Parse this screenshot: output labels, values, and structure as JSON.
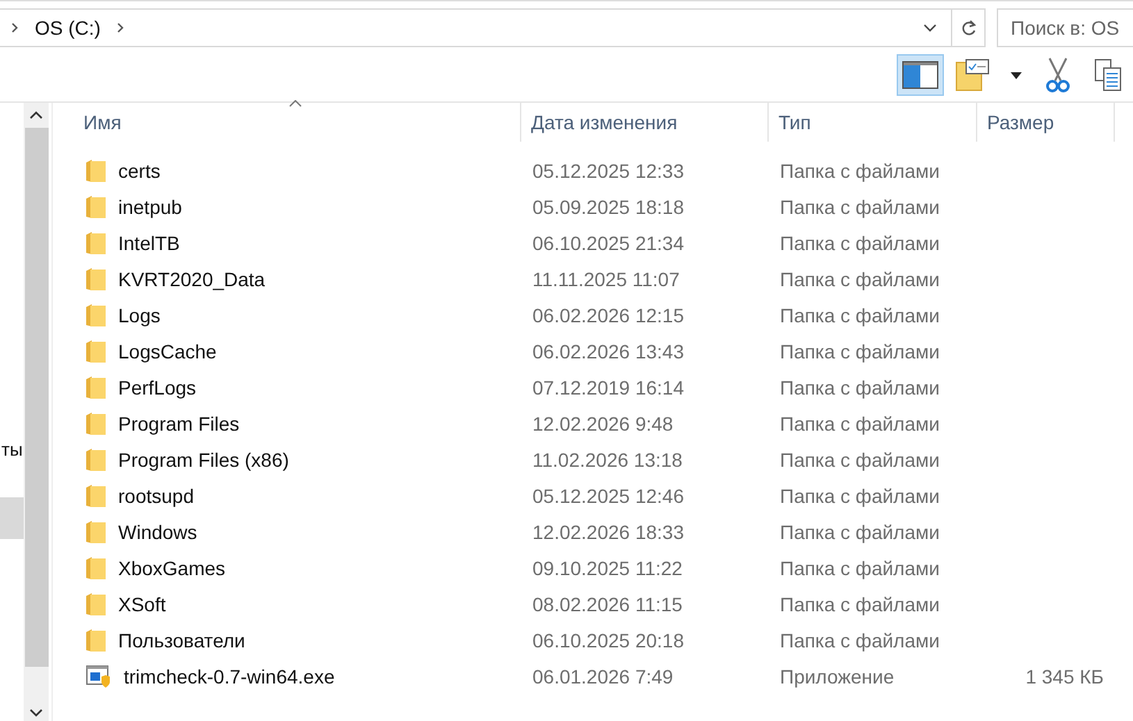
{
  "address_bar": {
    "path": [
      {
        "label": "OS (C:)"
      }
    ]
  },
  "search": {
    "placeholder": "Поиск в: OS"
  },
  "toolbar": {
    "buttons": [
      {
        "kind": "preview-pane",
        "selected": true
      },
      {
        "kind": "properties",
        "selected": false
      },
      {
        "kind": "cut",
        "selected": false
      },
      {
        "kind": "copy",
        "selected": false
      }
    ]
  },
  "navigation": {
    "items": [
      {
        "label": "ты",
        "selected": false
      },
      {
        "selected": true
      }
    ]
  },
  "table": {
    "columns": [
      {
        "label": "Имя",
        "sorted": true
      },
      {
        "label": "Дата изменения",
        "sorted": false
      },
      {
        "label": "Тип",
        "sorted": false
      },
      {
        "label": "Размер",
        "sorted": false
      }
    ],
    "rows": [
      {
        "kind": "folder",
        "name": "certs",
        "date": "05.12.2025 12:33",
        "type": "Папка с файлами"
      },
      {
        "kind": "folder",
        "name": "inetpub",
        "date": "05.09.2025 18:18",
        "type": "Папка с файлами"
      },
      {
        "kind": "folder",
        "name": "IntelTB",
        "date": "06.10.2025 21:34",
        "type": "Папка с файлами"
      },
      {
        "kind": "folder",
        "name": "KVRT2020_Data",
        "date": "11.11.2025 11:07",
        "type": "Папка с файлами"
      },
      {
        "kind": "folder",
        "name": "Logs",
        "date": "06.02.2026 12:15",
        "type": "Папка с файлами"
      },
      {
        "kind": "folder",
        "name": "LogsCache",
        "date": "06.02.2026 13:43",
        "type": "Папка с файлами"
      },
      {
        "kind": "folder",
        "name": "PerfLogs",
        "date": "07.12.2019 16:14",
        "type": "Папка с файлами"
      },
      {
        "kind": "folder",
        "name": "Program Files",
        "date": "12.02.2026 9:48",
        "type": "Папка с файлами"
      },
      {
        "kind": "folder",
        "name": "Program Files (x86)",
        "date": "11.02.2026 13:18",
        "type": "Папка с файлами"
      },
      {
        "kind": "folder",
        "name": "rootsupd",
        "date": "05.12.2025 12:46",
        "type": "Папка с файлами"
      },
      {
        "kind": "folder",
        "name": "Windows",
        "date": "12.02.2026 18:33",
        "type": "Папка с файлами"
      },
      {
        "kind": "folder",
        "name": "XboxGames",
        "date": "09.10.2025 11:22",
        "type": "Папка с файлами"
      },
      {
        "kind": "folder",
        "name": "XSoft",
        "date": "08.02.2026 11:15",
        "type": "Папка с файлами"
      },
      {
        "kind": "folder",
        "name": "Пользователи",
        "date": "06.10.2025 20:18",
        "type": "Папка с файлами"
      },
      {
        "kind": "app",
        "name": "trimcheck-0.7-win64.exe",
        "date": "06.01.2026 7:49",
        "type": "Приложение",
        "size": "1 345 КБ"
      }
    ]
  }
}
